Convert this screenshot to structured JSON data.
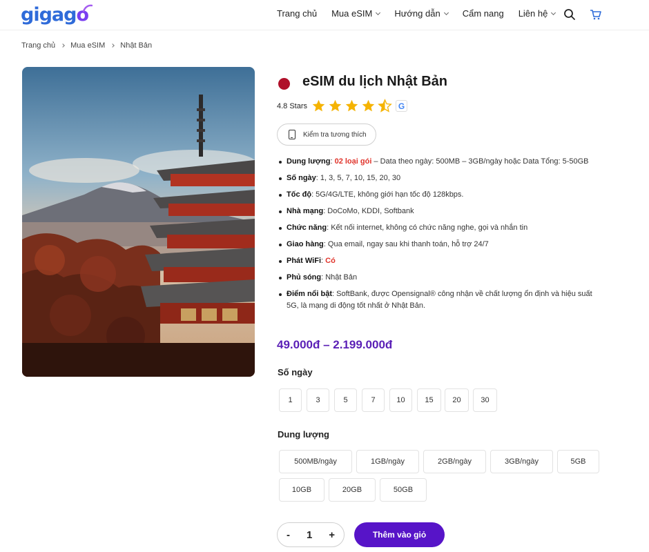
{
  "header": {
    "logo_text": "gigago",
    "nav": [
      {
        "label": "Trang chủ"
      },
      {
        "label": "Mua eSIM"
      },
      {
        "label": "Hướng dẫn"
      },
      {
        "label": "Cẩm nang"
      },
      {
        "label": "Liên hệ"
      }
    ]
  },
  "breadcrumb": [
    "Trang chủ",
    "Mua eSIM",
    "Nhật Bản"
  ],
  "product": {
    "title": "eSIM du lịch Nhật Bản",
    "rating_text": "4.8 Stars",
    "rating": 4.5,
    "rating_max": 5,
    "compat_button": "Kiểm tra tương thích",
    "features": [
      {
        "label": "Dung lượng",
        "highlight": "02 loại gói",
        "text": " – Data theo ngày: 500MB – 3GB/ngày hoặc Data Tổng: 5-50GB"
      },
      {
        "label": "Số ngày",
        "text": ": 1, 3, 5, 7, 10, 15, 20, 30"
      },
      {
        "label": "Tốc độ",
        "text": ": 5G/4G/LTE, không giới hạn tốc độ 128kbps."
      },
      {
        "label": "Nhà mạng",
        "text": ": DoCoMo, KDDI, Softbank"
      },
      {
        "label": "Chức năng",
        "text": ": Kết nối internet, không có chức năng nghe, gọi và nhắn tin"
      },
      {
        "label": "Giao hàng",
        "text": ": Qua email, ngay sau khi thanh toán, hỗ trợ 24/7"
      },
      {
        "label": "Phát WiFi",
        "highlight": "Có",
        "text": ""
      },
      {
        "label": "Phủ sóng",
        "text": ": Nhật Bản"
      },
      {
        "label": "Điểm nổi bật",
        "text": ": SoftBank, được Opensignal® công nhận về chất lượng ổn định và hiệu suất 5G, là mạng di động tốt nhất ở Nhật Bản."
      }
    ],
    "price": "49.000đ – 2.199.000đ",
    "days_label": "Số ngày",
    "days": [
      "1",
      "3",
      "5",
      "7",
      "10",
      "15",
      "20",
      "30"
    ],
    "data_label": "Dung lượng",
    "data_options": [
      "500MB/ngày",
      "1GB/ngày",
      "2GB/ngày",
      "3GB/ngày",
      "5GB",
      "10GB",
      "20GB",
      "50GB"
    ],
    "quantity": "1",
    "qty_minus": "-",
    "qty_plus": "+",
    "add_to_cart": "Thêm vào giỏ"
  },
  "colors": {
    "brand_blue": "#2f6bd9",
    "accent_purple": "#5714c8",
    "price_purple": "#5a1fb6",
    "highlight_red": "#e0342b",
    "star": "#f5b301"
  }
}
